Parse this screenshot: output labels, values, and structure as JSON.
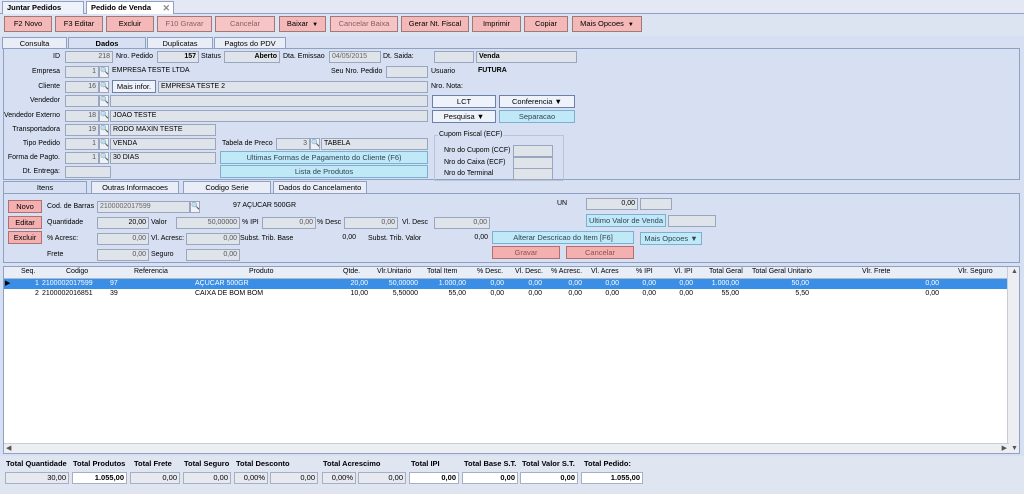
{
  "doc_tabs": [
    {
      "label": "Juntar Pedidos"
    },
    {
      "label": "Pedido de Venda"
    }
  ],
  "toolbar": {
    "novo": "F2 Novo",
    "editar": "F3 Editar",
    "excluir": "Excluir",
    "gravar": "F10 Gravar",
    "cancelar": "Cancelar",
    "baixar": "Baixar",
    "cancelar_baixa": "Cancelar Baixa",
    "gerar_nf": "Gerar Nt. Fiscal",
    "imprimir": "Imprimir",
    "copiar": "Copiar",
    "mais_opcoes": "Mais Opcoes"
  },
  "sub_tabs": [
    "Consulta",
    "Dados",
    "Duplicatas",
    "Pagtos do PDV"
  ],
  "header": {
    "id_label": "ID",
    "id_value": "218",
    "nro_pedido_label": "Nro. Pedido",
    "nro_pedido_value": "157",
    "status_label": "Status",
    "status_value": "Aberto",
    "dta_emissao_label": "Dta. Emissao",
    "dta_emissao_value": "04/05/2015",
    "dt_saida_label": "Dt. Saida:",
    "dt_saida_value": "",
    "tipo_venda": "Venda",
    "empresa_label": "Empresa",
    "empresa_code": "1",
    "empresa_name": "EMPRESA TESTE LTDA",
    "seu_nro_pedido_label": "Seu Nro. Pedido",
    "usuario_label": "Usuario",
    "usuario_value": "FUTURA",
    "cliente_label": "Cliente",
    "cliente_code": "16",
    "mais_infor": "Mais infor.",
    "cliente_name": "EMPRESA TESTE 2",
    "nro_nota_label": "Nro. Nota:",
    "vendedor_label": "Vendedor",
    "vendedor_externo_label": "Vendedor Externo",
    "vendedor_externo_code": "18",
    "vendedor_externo_name": "JOAO TESTE",
    "transportadora_label": "Transportadora",
    "transportadora_code": "19",
    "transportadora_name": "RODO MAXIN TESTE",
    "tipo_pedido_label": "Tipo Pedido",
    "tipo_pedido_code": "1",
    "tipo_pedido_name": "VENDA",
    "forma_pagto_label": "Forma de Pagto.",
    "forma_pagto_code": "1",
    "forma_pagto_name": "30 DIAS",
    "dt_entrega_label": "Dt. Entrega:",
    "tabela_preco_label": "Tabela de Preco",
    "tabela_preco_code": "3",
    "tabela_preco_name": "TABELA",
    "ultimas_formas": "Ultimas Formas de Pagamento do Cliente (F6)",
    "lista_produtos": "Lista de Produtos",
    "lct": "LCT",
    "conferencia": "Conferencia",
    "pesquisa": "Pesquisa",
    "separacao": "Separacao",
    "cupom_title": "Cupom Fiscal (ECF)",
    "nro_cupom_label": "Nro do Cupom (CCF)",
    "nro_caixa_label": "Nro do Caixa (ECF)",
    "nro_terminal_label": "Nro do Terminal"
  },
  "item_tabs": [
    "Itens",
    "Outras Informacoes",
    "Codigo Serie",
    "Dados do Cancelamento"
  ],
  "item_form": {
    "novo": "Novo",
    "editar": "Editar",
    "excluir": "Excluir",
    "cod_barras_label": "Cod. de Barras",
    "cod_barras_value": "2100002017599",
    "produto_code": "97",
    "produto_name": "AÇUCAR 500GR",
    "un_label": "UN",
    "un_value": "0,00",
    "quantidade_label": "Quantidade",
    "quantidade_value": "20,00",
    "valor_label": "Valor",
    "valor_value": "50,00000",
    "ipi_label": "% IPI",
    "ipi_value": "0,00",
    "desc_pct_label": "% Desc",
    "desc_pct_value": "0,00",
    "vl_desc_label": "Vl. Desc",
    "vl_desc_value": "0,00",
    "ultimo_valor": "Ultimo Valor de Venda",
    "acresc_label": "% Acresc:",
    "acresc_value": "0,00",
    "vl_acresc_label": "Vl. Acresc:",
    "vl_acresc_value": "0,00",
    "subst_base_label": "Subst. Trib. Base",
    "subst_base_value": "0,00",
    "subst_valor_label": "Subst. Trib. Valor",
    "subst_valor_value": "0,00",
    "alterar_descricao": "Alterar Descricao do Item [F6]",
    "mais_opcoes": "Mais Opcoes",
    "frete_label": "Frete",
    "frete_value": "0,00",
    "seguro_label": "Seguro",
    "seguro_value": "0,00",
    "gravar": "Gravar",
    "cancelar": "Cancelar"
  },
  "grid": {
    "columns": [
      "Seq.",
      "Codigo",
      "Referencia",
      "Produto",
      "Qtde.",
      "Vlr.Unitario",
      "Total Item",
      "% Desc.",
      "Vl. Desc.",
      "% Acresc.",
      "Vl. Acres",
      "% IPI",
      "Vl. IPI",
      "Total Geral",
      "Total Geral Unitario",
      "Vlr. Frete",
      "Vlr. Seguro"
    ],
    "rows": [
      {
        "seq": "1",
        "codigo": "2100002017599",
        "referencia": "97",
        "produto": "AÇUCAR 500GR",
        "qtde": "20,00",
        "vlr_unit": "50,00000",
        "total_item": "1.000,00",
        "desc_pct": "0,00",
        "vl_desc": "0,00",
        "acresc_pct": "0,00",
        "vl_acres": "0,00",
        "ipi_pct": "0,00",
        "vl_ipi": "0,00",
        "total_geral": "1.000,00",
        "total_geral_unit": "50,00",
        "vlr_frete": "0,00"
      },
      {
        "seq": "2",
        "codigo": "2100002016851",
        "referencia": "39",
        "produto": "CAIXA DE BOM BOM",
        "qtde": "10,00",
        "vlr_unit": "5,50000",
        "total_item": "55,00",
        "desc_pct": "0,00",
        "vl_desc": "0,00",
        "acresc_pct": "0,00",
        "vl_acres": "0,00",
        "ipi_pct": "0,00",
        "vl_ipi": "0,00",
        "total_geral": "55,00",
        "total_geral_unit": "5,50",
        "vlr_frete": "0,00"
      }
    ]
  },
  "totals": {
    "total_quantidade_label": "Total Quantidade",
    "total_quantidade": "30,00",
    "total_produtos_label": "Total Produtos",
    "total_produtos": "1.055,00",
    "total_frete_label": "Total Frete",
    "total_frete": "0,00",
    "total_seguro_label": "Total Seguro",
    "total_seguro": "0,00",
    "total_desconto_label": "Total Desconto",
    "total_desconto_pct": "0,00%",
    "total_desconto": "0,00",
    "total_acrescimo_label": "Total Acrescimo",
    "total_acrescimo_pct": "0,00%",
    "total_acrescimo": "0,00",
    "total_ipi_label": "Total IPI",
    "total_ipi": "0,00",
    "total_base_st_label": "Total Base S.T.",
    "total_base_st": "0,00",
    "total_valor_st_label": "Total Valor S.T.",
    "total_valor_st": "0,00",
    "total_pedido_label": "Total Pedido:",
    "total_pedido": "1.055,00"
  }
}
